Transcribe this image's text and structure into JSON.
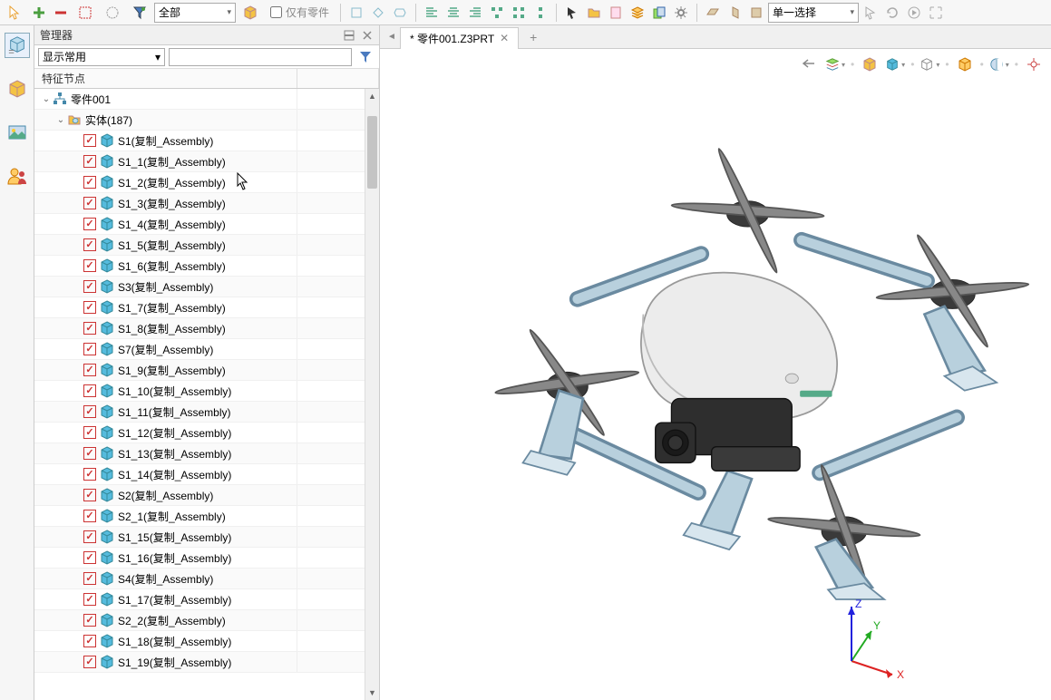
{
  "toolbar": {
    "filter_all": "全部",
    "parts_only": "仅有零件",
    "single_select": "单一选择"
  },
  "manager": {
    "title": "管理器",
    "show_common": "显示常用",
    "feature_node_header": "特征节点"
  },
  "tree": {
    "root": "零件001",
    "entity_label": "实体(187)",
    "items": [
      "S1(复制_Assembly)",
      "S1_1(复制_Assembly)",
      "S1_2(复制_Assembly)",
      "S1_3(复制_Assembly)",
      "S1_4(复制_Assembly)",
      "S1_5(复制_Assembly)",
      "S1_6(复制_Assembly)",
      "S3(复制_Assembly)",
      "S1_7(复制_Assembly)",
      "S1_8(复制_Assembly)",
      "S7(复制_Assembly)",
      "S1_9(复制_Assembly)",
      "S1_10(复制_Assembly)",
      "S1_11(复制_Assembly)",
      "S1_12(复制_Assembly)",
      "S1_13(复制_Assembly)",
      "S1_14(复制_Assembly)",
      "S2(复制_Assembly)",
      "S2_1(复制_Assembly)",
      "S1_15(复制_Assembly)",
      "S1_16(复制_Assembly)",
      "S4(复制_Assembly)",
      "S1_17(复制_Assembly)",
      "S2_2(复制_Assembly)",
      "S1_18(复制_Assembly)",
      "S1_19(复制_Assembly)"
    ]
  },
  "tab": {
    "active_name": "* 零件001.Z3PRT"
  },
  "axis": {
    "x": "X",
    "y": "Y",
    "z": "Z"
  }
}
